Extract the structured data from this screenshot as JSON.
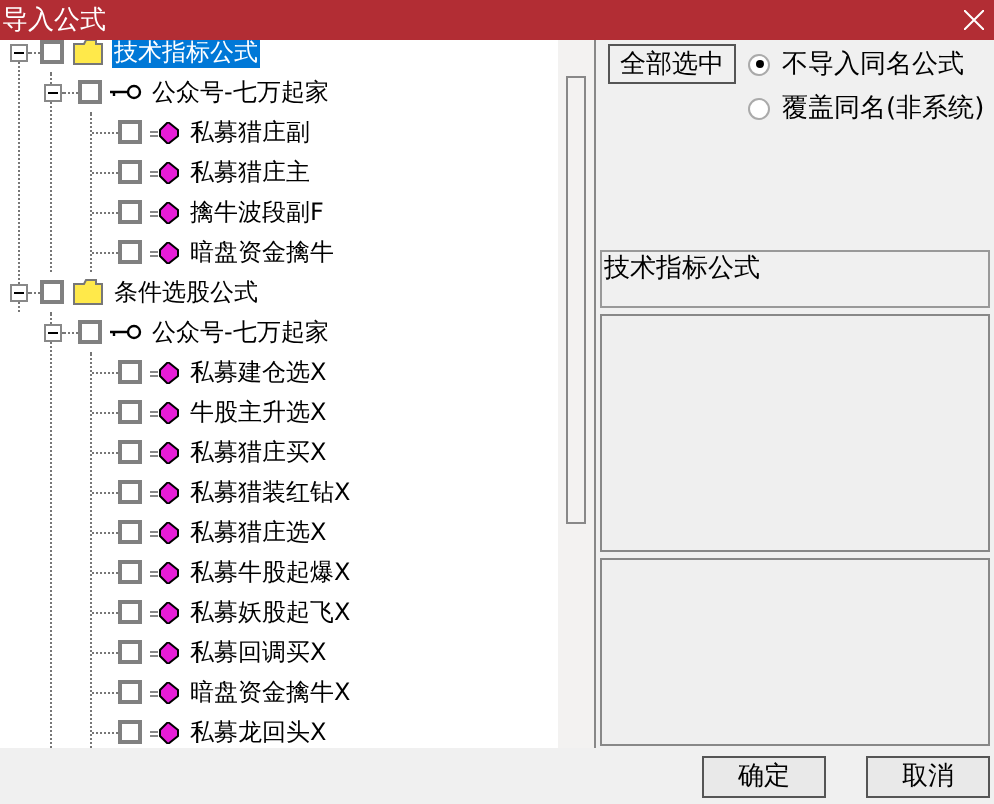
{
  "window": {
    "title": "导入公式"
  },
  "tree": [
    {
      "label": "技术指标公式",
      "kind": "folder",
      "expanded": true,
      "checked": false,
      "selected": true,
      "children": [
        {
          "label": "公众号-七万起家",
          "kind": "group",
          "expanded": true,
          "checked": false,
          "selected": false,
          "children": [
            {
              "label": "私募猎庄副",
              "kind": "formula",
              "checked": false,
              "selected": false
            },
            {
              "label": "私募猎庄主",
              "kind": "formula",
              "checked": false,
              "selected": false
            },
            {
              "label": "擒牛波段副F",
              "kind": "formula",
              "checked": false,
              "selected": false
            },
            {
              "label": "暗盘资金擒牛",
              "kind": "formula",
              "checked": false,
              "selected": false
            }
          ]
        }
      ]
    },
    {
      "label": "条件选股公式",
      "kind": "folder",
      "expanded": true,
      "checked": false,
      "selected": false,
      "children": [
        {
          "label": "公众号-七万起家",
          "kind": "group",
          "expanded": true,
          "checked": false,
          "selected": false,
          "children": [
            {
              "label": "私募建仓选X",
              "kind": "formula",
              "checked": false,
              "selected": false
            },
            {
              "label": "牛股主升选X",
              "kind": "formula",
              "checked": false,
              "selected": false
            },
            {
              "label": "私募猎庄买X",
              "kind": "formula",
              "checked": false,
              "selected": false
            },
            {
              "label": "私募猎装红钻X",
              "kind": "formula",
              "checked": false,
              "selected": false
            },
            {
              "label": "私募猎庄选X",
              "kind": "formula",
              "checked": false,
              "selected": false
            },
            {
              "label": "私募牛股起爆X",
              "kind": "formula",
              "checked": false,
              "selected": false
            },
            {
              "label": "私募妖股起飞X",
              "kind": "formula",
              "checked": false,
              "selected": false
            },
            {
              "label": "私募回调买X",
              "kind": "formula",
              "checked": false,
              "selected": false
            },
            {
              "label": "暗盘资金擒牛X",
              "kind": "formula",
              "checked": false,
              "selected": false
            },
            {
              "label": "私募龙回头X",
              "kind": "formula",
              "checked": false,
              "selected": false
            }
          ]
        }
      ]
    }
  ],
  "select_all_button": "全部选中",
  "options": [
    {
      "label": "不导入同名公式",
      "selected": true
    },
    {
      "label": "覆盖同名(非系统)",
      "selected": false
    }
  ],
  "info_text": "技术指标公式",
  "buttons": [
    "确定",
    "取消"
  ]
}
